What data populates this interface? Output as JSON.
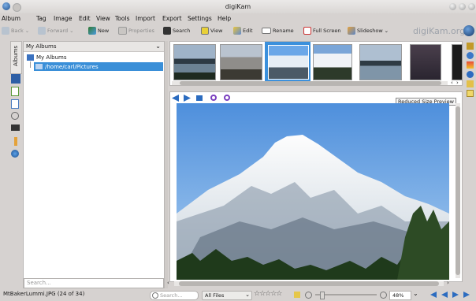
{
  "window": {
    "title": "digiKam"
  },
  "menubar": [
    "Album",
    "Tag",
    "Image",
    "Edit",
    "View",
    "Tools",
    "Import",
    "Export",
    "Settings",
    "Help"
  ],
  "toolbar": {
    "back": "Back",
    "forward": "Forward",
    "new": "New",
    "properties": "Properties",
    "search": "Search",
    "view": "View",
    "edit": "Edit",
    "rename": "Rename",
    "fullscreen": "Full Screen",
    "slideshow": "Slideshow",
    "brand": "digiKam.org"
  },
  "left_tabs": {
    "albums_label": "Albums"
  },
  "album_panel": {
    "header": "My Albums",
    "root": "My Albums",
    "child": "/home/carl/Pictures",
    "search_placeholder": "Search..."
  },
  "thumbnails": [
    "mountain-lake",
    "mountain-haze",
    "mountain-blue-sky",
    "mountain-snow",
    "lake-shore",
    "dark-cloud",
    "partial"
  ],
  "preview": {
    "badge": "Reduced Size Preview"
  },
  "status": {
    "filename": "MtBakerLummi.JPG (24 of 34)",
    "search_placeholder": "Search...",
    "filter": "All Files",
    "zoom": "48%"
  },
  "colors": {
    "selection": "#3a8fd8",
    "thumb_selected": "#3b90dc",
    "sky": "#6aa7e8"
  }
}
